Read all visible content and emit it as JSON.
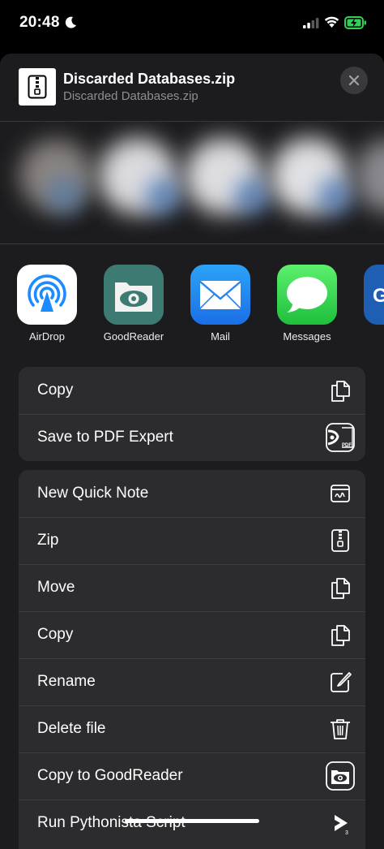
{
  "status_bar": {
    "time": "20:48",
    "icons": [
      "moon-icon",
      "cellular-signal-icon",
      "wifi-icon",
      "battery-charging-icon"
    ]
  },
  "header": {
    "title": "Discarded Databases.zip",
    "subtitle": "Discarded Databases.zip",
    "file_icon": "zip-file-icon",
    "close_icon": "close-icon"
  },
  "apps": [
    {
      "label": "AirDrop",
      "icon": "airdrop-icon",
      "color": "#ffffff"
    },
    {
      "label": "GoodReader",
      "icon": "goodreader-icon",
      "color": "#3d7a72"
    },
    {
      "label": "Mail",
      "icon": "mail-icon",
      "color": "#2f8cf2"
    },
    {
      "label": "Messages",
      "icon": "messages-icon",
      "color": "#34c759"
    },
    {
      "label": "GM",
      "icon": "gm-app-icon",
      "color": "#1e5fb4"
    }
  ],
  "group1": [
    {
      "label": "Copy",
      "icon": "copy-icon"
    },
    {
      "label": "Save to PDF Expert",
      "icon": "pdf-expert-icon"
    }
  ],
  "group2": [
    {
      "label": "New Quick Note",
      "icon": "quick-note-icon"
    },
    {
      "label": "Zip",
      "icon": "zip-icon"
    },
    {
      "label": "Move",
      "icon": "move-icon"
    },
    {
      "label": "Copy",
      "icon": "copy-icon"
    },
    {
      "label": "Rename",
      "icon": "rename-icon"
    },
    {
      "label": "Delete file",
      "icon": "trash-icon"
    },
    {
      "label": "Copy to GoodReader",
      "icon": "goodreader-action-icon"
    },
    {
      "label": "Run Pythonista Script",
      "icon": "pythonista-icon"
    }
  ],
  "colors": {
    "background": "#000000",
    "sheet": "#1c1c1e",
    "group": "#2c2c2e",
    "secondary_text": "#8e8e93",
    "battery_green": "#30d158"
  }
}
